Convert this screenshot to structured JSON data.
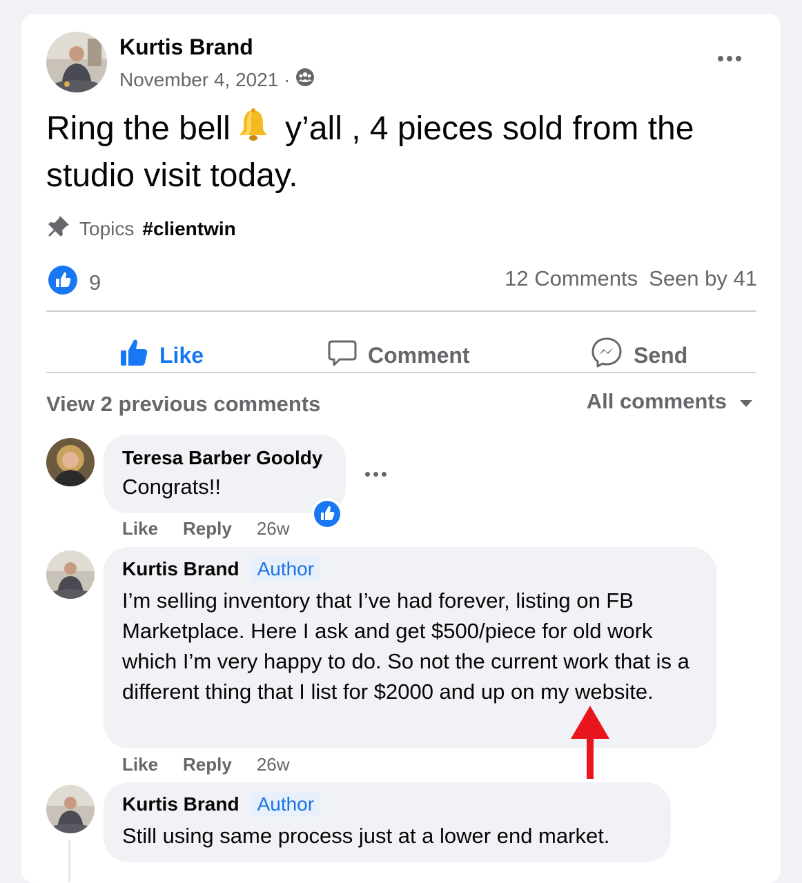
{
  "post": {
    "author": "Kurtis Brand",
    "date": "November 4, 2021 ·",
    "privacy_icon": "group-icon",
    "text_before": "Ring the bell",
    "text_after": " y’all , 4 pieces sold from the studio visit today.",
    "emoji": "bell",
    "topics_label": "Topics",
    "topic_tag": "#clientwin",
    "reaction_count": "9",
    "comments_count": "12 Comments",
    "seen_by": "Seen by 41"
  },
  "actions": {
    "like": "Like",
    "comment": "Comment",
    "send": "Send"
  },
  "comments_header": {
    "view_previous": "View 2 previous comments",
    "filter": "All comments"
  },
  "comments": [
    {
      "author": "Teresa Barber Gooldy",
      "text": "Congrats!!",
      "like": "Like",
      "reply": "Reply",
      "time": "26w",
      "has_reaction": true
    },
    {
      "author": "Kurtis Brand",
      "badge": "Author",
      "text": "I’m selling inventory that I’ve had forever, listing on FB Marketplace. Here I ask and get $500/piece for old work which I’m very happy to do. So not the current work that is a different thing that I list for $2000 and up on my website.",
      "like": "Like",
      "reply": "Reply",
      "time": "26w"
    },
    {
      "author": "Kurtis Brand",
      "badge": "Author",
      "text": "Still using same process just at a lower end market."
    }
  ],
  "colors": {
    "accent_blue": "#1877f2",
    "muted_text": "#65676b",
    "annotation_arrow": "#e8161c"
  }
}
